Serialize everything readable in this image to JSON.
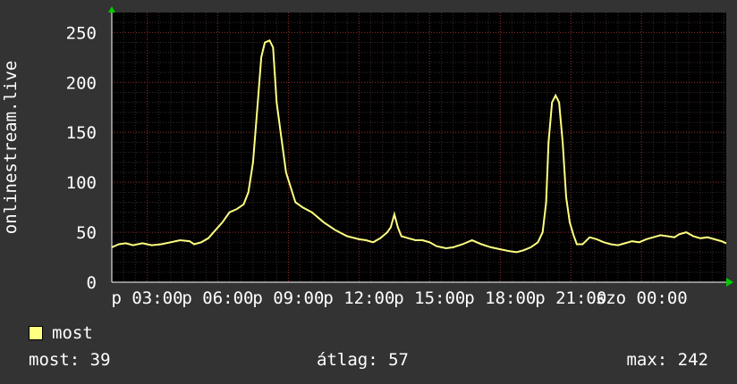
{
  "chart_data": {
    "type": "line",
    "ylabel": "onlinestream.live",
    "ylim": [
      0,
      270
    ],
    "yticks": [
      0,
      50,
      100,
      150,
      200,
      250
    ],
    "x_range_hours": [
      1.5,
      25.25
    ],
    "xticks": [
      {
        "hour": 3,
        "label": "p 03:00"
      },
      {
        "hour": 6,
        "label": "p 06:00"
      },
      {
        "hour": 9,
        "label": "p 09:00"
      },
      {
        "hour": 12,
        "label": "p 12:00"
      },
      {
        "hour": 15,
        "label": "p 15:00"
      },
      {
        "hour": 18,
        "label": "p 18:00"
      },
      {
        "hour": 21,
        "label": "p 21:00"
      },
      {
        "hour": 24,
        "label": "szo 00:00"
      }
    ],
    "grid": true,
    "legend_position": "bottom-left",
    "series": [
      {
        "name": "most",
        "color": "#ffff80",
        "points": [
          [
            1.5,
            35
          ],
          [
            1.8,
            38
          ],
          [
            2.1,
            39
          ],
          [
            2.4,
            37
          ],
          [
            2.8,
            39
          ],
          [
            3.2,
            37
          ],
          [
            3.6,
            38
          ],
          [
            4.0,
            40
          ],
          [
            4.4,
            42
          ],
          [
            4.8,
            41
          ],
          [
            5.0,
            38
          ],
          [
            5.3,
            40
          ],
          [
            5.6,
            44
          ],
          [
            5.9,
            52
          ],
          [
            6.2,
            60
          ],
          [
            6.5,
            70
          ],
          [
            6.8,
            73
          ],
          [
            7.1,
            78
          ],
          [
            7.3,
            90
          ],
          [
            7.5,
            120
          ],
          [
            7.7,
            180
          ],
          [
            7.85,
            225
          ],
          [
            8.0,
            240
          ],
          [
            8.2,
            242
          ],
          [
            8.35,
            235
          ],
          [
            8.5,
            180
          ],
          [
            8.7,
            145
          ],
          [
            8.9,
            110
          ],
          [
            9.1,
            95
          ],
          [
            9.3,
            80
          ],
          [
            9.6,
            75
          ],
          [
            10.0,
            70
          ],
          [
            10.5,
            60
          ],
          [
            11.0,
            52
          ],
          [
            11.5,
            46
          ],
          [
            12.0,
            43
          ],
          [
            12.3,
            42
          ],
          [
            12.6,
            40
          ],
          [
            12.9,
            44
          ],
          [
            13.2,
            50
          ],
          [
            13.35,
            55
          ],
          [
            13.5,
            68
          ],
          [
            13.65,
            55
          ],
          [
            13.8,
            46
          ],
          [
            14.1,
            44
          ],
          [
            14.4,
            42
          ],
          [
            14.7,
            42
          ],
          [
            15.0,
            40
          ],
          [
            15.3,
            36
          ],
          [
            15.7,
            34
          ],
          [
            16.0,
            35
          ],
          [
            16.4,
            38
          ],
          [
            16.8,
            42
          ],
          [
            17.2,
            38
          ],
          [
            17.6,
            35
          ],
          [
            18.0,
            33
          ],
          [
            18.4,
            31
          ],
          [
            18.7,
            30
          ],
          [
            19.0,
            32
          ],
          [
            19.3,
            35
          ],
          [
            19.6,
            40
          ],
          [
            19.8,
            50
          ],
          [
            19.95,
            80
          ],
          [
            20.05,
            140
          ],
          [
            20.2,
            180
          ],
          [
            20.35,
            187
          ],
          [
            20.5,
            180
          ],
          [
            20.65,
            140
          ],
          [
            20.8,
            85
          ],
          [
            20.95,
            60
          ],
          [
            21.1,
            48
          ],
          [
            21.25,
            38
          ],
          [
            21.5,
            38
          ],
          [
            21.8,
            45
          ],
          [
            22.1,
            43
          ],
          [
            22.4,
            40
          ],
          [
            22.7,
            38
          ],
          [
            23.0,
            37
          ],
          [
            23.3,
            39
          ],
          [
            23.6,
            41
          ],
          [
            23.9,
            40
          ],
          [
            24.2,
            43
          ],
          [
            24.5,
            45
          ],
          [
            24.8,
            47
          ],
          [
            25.1,
            46
          ],
          [
            25.4,
            45
          ],
          [
            25.6,
            48
          ],
          [
            25.9,
            50
          ],
          [
            26.2,
            46
          ],
          [
            26.5,
            44
          ],
          [
            26.8,
            45
          ],
          [
            27.1,
            43
          ],
          [
            27.4,
            41
          ],
          [
            27.6,
            39
          ]
        ]
      }
    ]
  },
  "legend": {
    "label": "most",
    "color": "#ffff80"
  },
  "stats": {
    "current": "most: 39",
    "average": "átlag: 57",
    "max": "max: 242"
  }
}
